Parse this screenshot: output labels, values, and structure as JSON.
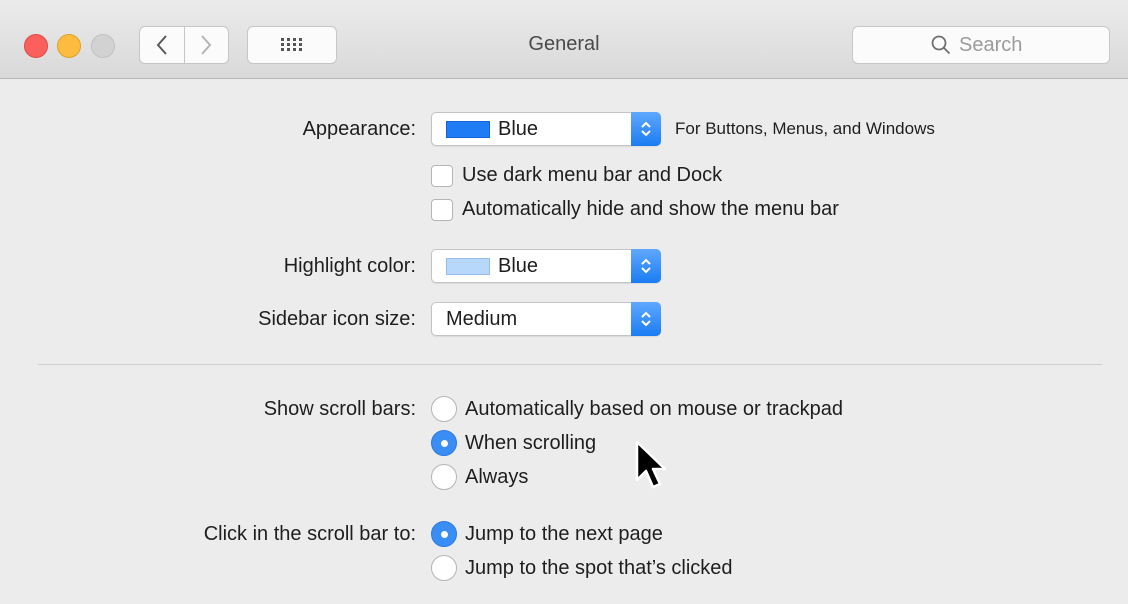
{
  "window": {
    "title": "General"
  },
  "toolbar": {
    "search_placeholder": "Search"
  },
  "colors": {
    "appearance_swatch": "#1f7cf5",
    "highlight_swatch": "#b8d8fb",
    "accent": "#3b8df6"
  },
  "appearance": {
    "label": "Appearance:",
    "value": "Blue",
    "note": "For Buttons, Menus, and Windows"
  },
  "menu_options": {
    "dark_menu_bar": {
      "label": "Use dark menu bar and Dock",
      "checked": false
    },
    "auto_hide_menu_bar": {
      "label": "Automatically hide and show the menu bar",
      "checked": false
    }
  },
  "highlight": {
    "label": "Highlight color:",
    "value": "Blue"
  },
  "sidebar_icon_size": {
    "label": "Sidebar icon size:",
    "value": "Medium"
  },
  "scroll_bars": {
    "label": "Show scroll bars:",
    "options": [
      {
        "label": "Automatically based on mouse or trackpad",
        "selected": false
      },
      {
        "label": "When scrolling",
        "selected": true
      },
      {
        "label": "Always",
        "selected": false
      }
    ]
  },
  "click_scroll_bar": {
    "label": "Click in the scroll bar to:",
    "options": [
      {
        "label": "Jump to the next page",
        "selected": true
      },
      {
        "label": "Jump to the spot that’s clicked",
        "selected": false
      }
    ]
  }
}
